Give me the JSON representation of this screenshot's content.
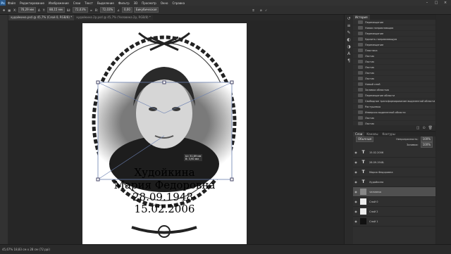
{
  "menubar": {
    "items": [
      "Файл",
      "Редактирование",
      "Изображение",
      "Слои",
      "Текст",
      "Выделение",
      "Фильтр",
      "3D",
      "Просмотр",
      "Окно",
      "Справка"
    ]
  },
  "options": {
    "x_label": "X:",
    "x_value": "76,29 мм",
    "y_label": "Y:",
    "y_value": "88,15 мм",
    "w_label": "Ш:",
    "w_value": "72,03%",
    "h_label": "В:",
    "h_value": "72,03%",
    "angle_value": "0,00",
    "interp_value": "Бикубическая"
  },
  "tabs": [
    {
      "label": "худойкина.psd @ 45,7% (Слой 0, RGB/8) *"
    },
    {
      "label": "худойкина 2p.psd @ 45,7% (Человека 2p, RGB/8) *"
    }
  ],
  "history": {
    "tab_label": "История",
    "items": [
      "Перемещение",
      "Новая направляющая",
      "Перемещение",
      "Удалить направляющую",
      "Перемещение",
      "Пластика",
      "Ластик",
      "Ластик",
      "Ластик",
      "Ластик",
      "Ластик",
      "Новый слой",
      "Заливка областью",
      "Перемещение области",
      "Свободное трансформирование выделенной области",
      "Растушевка",
      "Инверсия выделенной области",
      "Ластик",
      "Ластик",
      "Отменить выделение",
      "Удалить слой"
    ],
    "selected": 20
  },
  "layers_panel": {
    "tabs": [
      "Слои",
      "Каналы",
      "Контуры"
    ],
    "blend_mode": "Обычные",
    "opacity_label": "Непрозрачность:",
    "opacity_value": "100%",
    "fill_label": "Заливка:",
    "fill_value": "100%",
    "layers": [
      {
        "name": "15.02.2006",
        "kind": "T"
      },
      {
        "name": "28.09.1948-",
        "kind": "T"
      },
      {
        "name": "Мария Федоровна",
        "kind": "T"
      },
      {
        "name": "Худойкина",
        "kind": "T"
      },
      {
        "name": "человека",
        "kind": "img",
        "selected": true
      },
      {
        "name": "Слой 0",
        "kind": "img"
      },
      {
        "name": "Слой 2",
        "kind": "img"
      },
      {
        "name": "Слой 1",
        "kind": "img"
      }
    ]
  },
  "status": {
    "text": "45,67%   18,83 см x 28 см (72 ppi)"
  },
  "transform_readout": {
    "w": "Ш: 31,69 мм",
    "h": "В: 3,90 мм"
  },
  "document": {
    "surname": "Худойкина",
    "name_line": "Мария Федоровна",
    "date1": "28.09.1948-",
    "date2": "15.02.2006"
  }
}
